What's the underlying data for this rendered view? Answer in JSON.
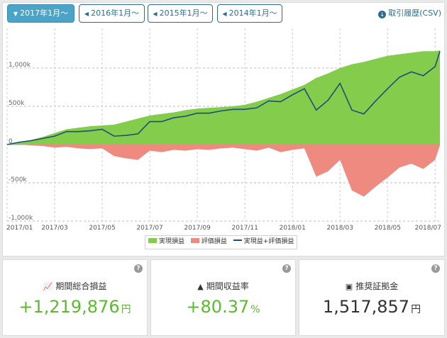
{
  "tabs": [
    {
      "label": "2017年1月～",
      "active": true,
      "icon": "caret-down-icon"
    },
    {
      "label": "2016年1月～",
      "active": false,
      "icon": "caret-left-icon"
    },
    {
      "label": "2015年1月～",
      "active": false,
      "icon": "caret-left-icon"
    },
    {
      "label": "2014年1月～",
      "active": false,
      "icon": "caret-left-icon"
    }
  ],
  "csv_label": "取引履歴(CSV)",
  "chart_data": {
    "type": "area",
    "x_ticks": [
      "2017/01",
      "2017/03",
      "2017/05",
      "2017/07",
      "2017/09",
      "2017/11",
      "2018/01",
      "2018/03",
      "2018/05",
      "2018/07"
    ],
    "y_ticks": [
      "1,000k",
      "500k",
      "0",
      "-500k",
      "-1,000k"
    ],
    "ylim": [
      -1000,
      1000
    ],
    "legend": [
      "実現損益",
      "評価損益",
      "実現益+評価損益"
    ],
    "colors": {
      "realized": "#84cc4c",
      "unrealized": "#ee8a80",
      "total": "#1f4e79"
    },
    "series": [
      {
        "name": "実現損益",
        "x": [
          0,
          0.5,
          1,
          1.5,
          2,
          2.5,
          3,
          3.5,
          4,
          4.5,
          5,
          5.5,
          6,
          6.5,
          7,
          7.5,
          8,
          8.5,
          9,
          9.5,
          10,
          10.5,
          11,
          11.5,
          12,
          12.5,
          13,
          13.5,
          14,
          14.5,
          15,
          15.5,
          16,
          16.5,
          17,
          17.5,
          18,
          18.2
        ],
        "values": [
          0,
          30,
          60,
          100,
          150,
          200,
          220,
          240,
          250,
          260,
          300,
          340,
          380,
          400,
          420,
          450,
          470,
          480,
          490,
          500,
          520,
          560,
          610,
          660,
          720,
          780,
          870,
          930,
          1000,
          1050,
          1080,
          1120,
          1160,
          1180,
          1200,
          1220,
          1220,
          1230
        ]
      },
      {
        "name": "評価損益",
        "x": [
          0,
          0.5,
          1,
          1.5,
          2,
          2.5,
          3,
          3.5,
          4,
          4.5,
          5,
          5.5,
          6,
          6.5,
          7,
          7.5,
          8,
          8.5,
          9,
          9.5,
          10,
          10.5,
          11,
          11.5,
          12,
          12.5,
          13,
          13.5,
          14,
          14.5,
          15,
          15.5,
          16,
          16.5,
          17,
          17.5,
          18,
          18.2
        ],
        "values": [
          0,
          0,
          -10,
          -20,
          -40,
          -30,
          -50,
          -60,
          -50,
          -150,
          -180,
          -200,
          -80,
          -100,
          -70,
          -80,
          -60,
          -70,
          -50,
          -40,
          -60,
          -80,
          -40,
          -100,
          -70,
          -50,
          -420,
          -350,
          -200,
          -600,
          -680,
          -550,
          -430,
          -300,
          -250,
          -320,
          -200,
          -10
        ]
      },
      {
        "name": "実現益+評価損益",
        "x": [
          0,
          0.5,
          1,
          1.5,
          2,
          2.5,
          3,
          3.5,
          4,
          4.5,
          5,
          5.5,
          6,
          6.5,
          7,
          7.5,
          8,
          8.5,
          9,
          9.5,
          10,
          10.5,
          11,
          11.5,
          12,
          12.5,
          13,
          13.5,
          14,
          14.5,
          15,
          15.5,
          16,
          16.5,
          17,
          17.5,
          18,
          18.2
        ],
        "values": [
          0,
          30,
          50,
          80,
          110,
          170,
          170,
          180,
          200,
          110,
          120,
          140,
          300,
          300,
          350,
          370,
          410,
          410,
          440,
          460,
          460,
          480,
          570,
          560,
          650,
          730,
          450,
          580,
          800,
          450,
          400,
          570,
          730,
          880,
          950,
          900,
          1020,
          1220
        ]
      }
    ]
  },
  "cards": [
    {
      "title": "期間総合損益",
      "value": "+1,219,876",
      "unit": "円",
      "icon": "line-chart-icon",
      "color": "#5cba2e"
    },
    {
      "title": "期間収益率",
      "value": "+80.37",
      "unit": "%",
      "icon": "area-chart-icon",
      "color": "#5cba2e"
    },
    {
      "title": "推奨証拠金",
      "value": "1,517,857",
      "unit": "円",
      "icon": "money-icon",
      "color": "#333333"
    }
  ],
  "help_glyph": "?"
}
